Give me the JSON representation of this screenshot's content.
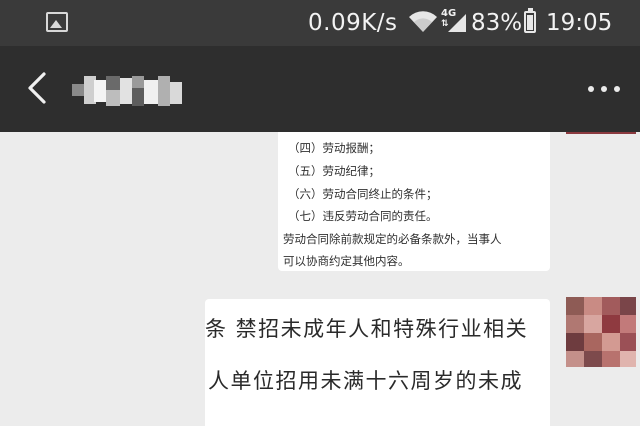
{
  "status_bar": {
    "network_speed": "0.09K/s",
    "network_type": "4G",
    "battery_percent": "83%",
    "battery_level": 0.83,
    "time": "19:05",
    "icons": [
      "gallery-icon",
      "wifi-icon",
      "mobile-data-icon",
      "signal-icon",
      "battery-icon"
    ]
  },
  "header": {
    "back_icon": "chevron-left-icon",
    "contact_name_pixelated": true,
    "more_icon": "more-dots-icon"
  },
  "messages": [
    {
      "id": "law-excerpt",
      "lines": [
        "（四）劳动报酬；",
        "（五）劳动纪律；",
        "（六）劳动合同终止的条件；",
        "（七）违反劳动合同的责任。",
        "劳动合同除前款规定的必备条款外，当事人",
        "可以协商约定其他内容。"
      ]
    },
    {
      "id": "article-excerpt",
      "lines": [
        "条 禁招未成年人和特殊行业相关",
        "人单位招用未满十六周岁的未成"
      ]
    }
  ],
  "colors": {
    "status_bar_bg": "#3a3a3a",
    "title_bar_bg": "#2e2e2e",
    "chat_bg": "#ececec",
    "bubble_bg": "#ffffff"
  }
}
